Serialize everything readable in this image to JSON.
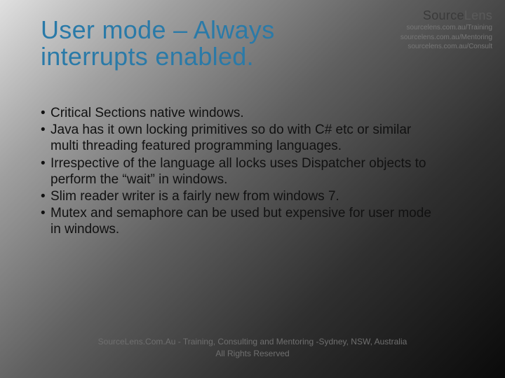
{
  "title": "User mode – Always interrupts enabled.",
  "brand": {
    "logo_main": "Source",
    "logo_sub": "Lens",
    "links": [
      "sourcelens.com.au/Training",
      "sourcelens.com.au/Mentoring",
      "sourcelens.com.au/Consult"
    ]
  },
  "bullets": [
    "Critical Sections native windows.",
    "Java has it own locking primitives so do with C# etc or similar multi threading featured programming languages.",
    "Irrespective of the language all locks uses Dispatcher objects to perform the  “wait”  in windows.",
    "Slim reader writer is a fairly new from windows 7.",
    "Mutex and semaphore can be used but expensive for user mode in windows."
  ],
  "footer": {
    "line1": "SourceLens.Com.Au - Training, Consulting and Mentoring -Sydney, NSW, Australia",
    "line2": "All Rights Reserved"
  }
}
